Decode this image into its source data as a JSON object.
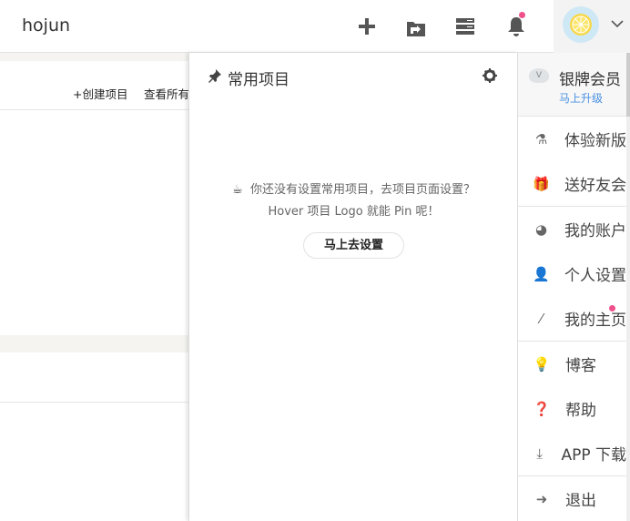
{
  "header": {
    "brand": "hojun"
  },
  "left": {
    "create": "+创建项目",
    "view_all": "查看所有"
  },
  "pinned": {
    "title": "常用项目",
    "empty_line1": "你还没有设置常用项目，去项目页面设置？",
    "empty_line2": "Hover 项目 Logo 就能 Pin 呢！",
    "set_button": "马上去设置"
  },
  "menu": {
    "level": "银牌会员",
    "level_badge": "V",
    "upgrade": "马上升级",
    "items": [
      {
        "label": "体验新版",
        "icon": "flask-icon"
      },
      {
        "label": "送好友会",
        "icon": "gift-icon"
      },
      {
        "label": "我的账户",
        "icon": "dashboard-icon"
      },
      {
        "label": "个人设置",
        "icon": "user-icon"
      },
      {
        "label": "我的主页",
        "icon": "magic-wand-icon"
      },
      {
        "label": "博客",
        "icon": "lightbulb-icon"
      },
      {
        "label": "帮助",
        "icon": "question-icon"
      },
      {
        "label": "APP 下载",
        "icon": "download-icon"
      },
      {
        "label": "退出",
        "icon": "sign-out-icon"
      }
    ]
  },
  "colors": {
    "accent": "#4a90e2",
    "notify": "#f0508a"
  }
}
